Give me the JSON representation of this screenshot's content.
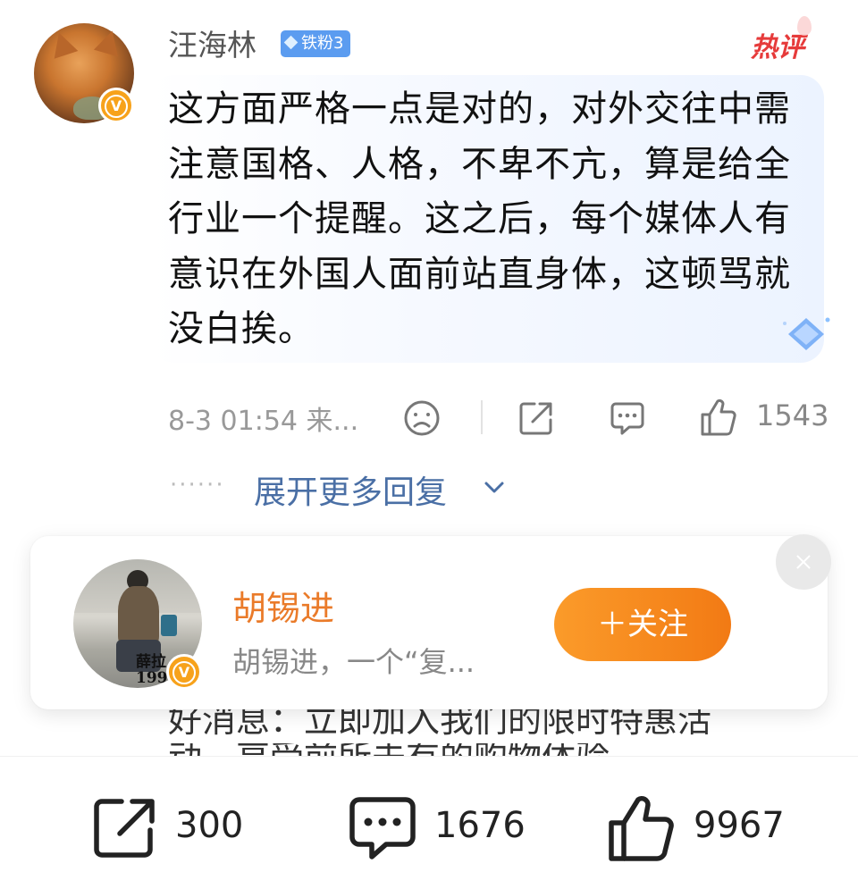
{
  "comment": {
    "username": "汪海林",
    "fan_badge": "铁粉3",
    "hot_label": "热评",
    "text": "这方面严格一点是对的，对外交往中需注意国格、人格，不卑不亢，算是给全行业一个提醒。这之后，每个媒体人有意识在外国人面前站直身体，这顿骂就没白挨。",
    "time": "8-3 01:54 来...",
    "likes": "1543"
  },
  "expand": {
    "dots": "······",
    "label": "展开更多回复"
  },
  "follow_card": {
    "name": "胡锡进",
    "description": "胡锡进，一个“复...",
    "follow_label": "＋关注",
    "avatar_signature": "薛拉\n199"
  },
  "background_text": {
    "line1": "好消息：立即加入我们的限时特惠活",
    "line2": "动，享受前所未有的购物体验"
  },
  "bottom_bar": {
    "share_count": "300",
    "comment_count": "1676",
    "like_count": "9967"
  },
  "colors": {
    "accent_orange": "#f27a14",
    "link_blue": "#4a6fa5",
    "badge_blue": "#5b9cf0",
    "verified_yellow": "#f7a21b",
    "hot_red": "#e63b3b"
  }
}
